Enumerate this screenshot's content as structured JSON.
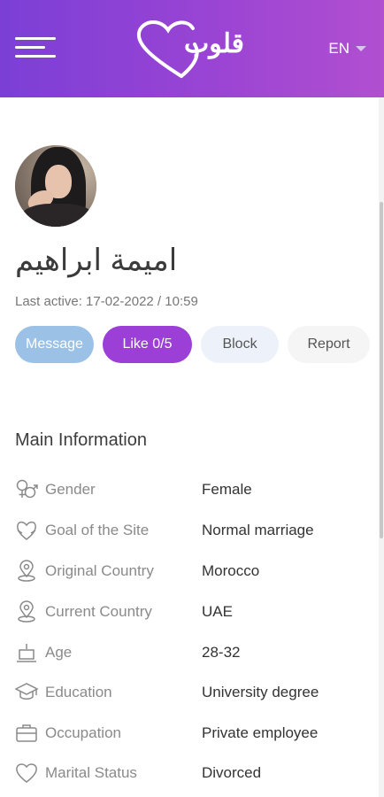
{
  "header": {
    "logo_text": "قلوب",
    "language": "EN",
    "colors": {
      "gradient_start": "#7b3fd6",
      "gradient_end": "#b14fd0"
    }
  },
  "profile": {
    "name": "اميمة ابراهيم",
    "last_active": "Last active: 17-02-2022 / 10:59"
  },
  "actions": {
    "message": "Message",
    "like": "Like 0/5",
    "block": "Block",
    "report": "Report"
  },
  "main_info": {
    "title": "Main Information",
    "rows": [
      {
        "icon": "gender-icon",
        "label": "Gender",
        "value": "Female"
      },
      {
        "icon": "heart-hands-icon",
        "label": "Goal of the Site",
        "value": "Normal marriage"
      },
      {
        "icon": "location-pin-icon",
        "label": "Original Country",
        "value": "Morocco"
      },
      {
        "icon": "location-pin-icon",
        "label": "Current Country",
        "value": "UAE"
      },
      {
        "icon": "birthday-cake-icon",
        "label": "Age",
        "value": "28-32"
      },
      {
        "icon": "graduation-cap-icon",
        "label": "Education",
        "value": "University degree"
      },
      {
        "icon": "briefcase-icon",
        "label": "Occupation",
        "value": "Private employee"
      },
      {
        "icon": "heart-icon",
        "label": "Marital Status",
        "value": "Divorced"
      }
    ]
  }
}
